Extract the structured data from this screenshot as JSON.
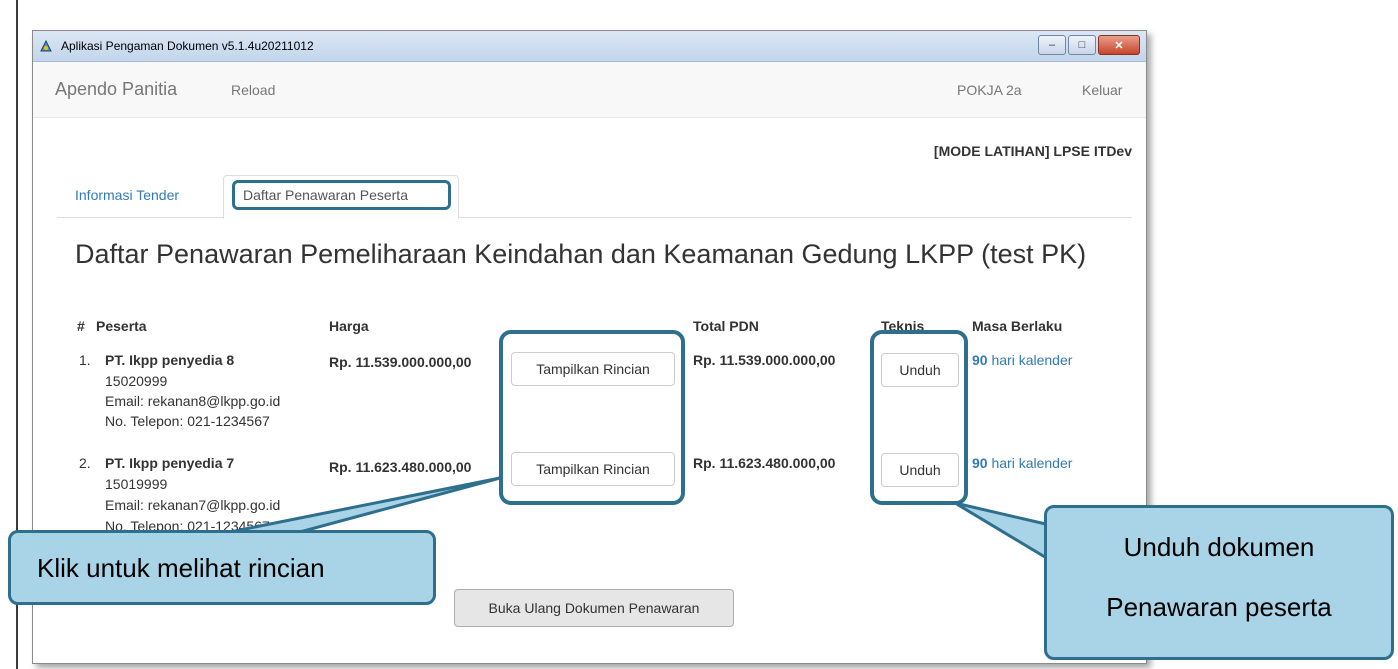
{
  "window": {
    "title": "Aplikasi Pengaman Dokumen v5.1.4u20211012"
  },
  "navbar": {
    "brand": "Apendo Panitia",
    "reload": "Reload",
    "user": "POKJA 2a",
    "logout": "Keluar"
  },
  "mode_label": "[MODE LATIHAN] LPSE ITDev",
  "tabs": [
    {
      "label": "Informasi Tender"
    },
    {
      "label": "Daftar Penawaran Peserta"
    }
  ],
  "heading": "Daftar Penawaran Pemeliharaan Keindahan dan Keamanan Gedung LKPP (test PK)",
  "table": {
    "headers": {
      "no": "#",
      "peserta": "Peserta",
      "harga": "Harga",
      "total_pdn": "Total PDN",
      "teknis": "Teknis",
      "masa": "Masa Berlaku"
    },
    "rows": [
      {
        "no": "1.",
        "name": "PT. Ikpp penyedia 8",
        "npwp": "15020999",
        "email": "Email: rekanan8@lkpp.go.id",
        "phone": "No. Telepon: 021-1234567",
        "harga": "Rp. 11.539.000.000,00",
        "detail_button": "Tampilkan Rincian",
        "total_pdn": "Rp. 11.539.000.000,00",
        "download_button": "Unduh",
        "masa_days": "90",
        "masa_unit": "hari kalender"
      },
      {
        "no": "2.",
        "name": "PT. Ikpp penyedia 7",
        "npwp": "15019999",
        "email": "Email: rekanan7@lkpp.go.id",
        "phone": "No. Telepon: 021-1234567",
        "harga": "Rp. 11.623.480.000,00",
        "detail_button": "Tampilkan Rincian",
        "total_pdn": "Rp. 11.623.480.000,00",
        "download_button": "Unduh",
        "masa_days": "90",
        "masa_unit": "hari kalender"
      }
    ]
  },
  "reopen_button": "Buka Ulang Dokumen Penawaran",
  "callouts": {
    "left": "Klik untuk melihat rincian",
    "right_line1": "Unduh dokumen",
    "right_line2": "Penawaran peserta"
  },
  "colors": {
    "highlight": "#2e6f8e",
    "callout_fill": "#a9d3e6",
    "link": "#337ab7"
  }
}
